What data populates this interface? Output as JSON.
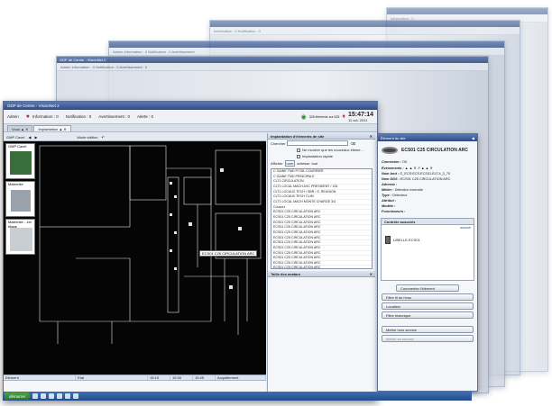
{
  "window": {
    "title": "GDP de Centre - VisionNet 2"
  },
  "background_windows": [
    {
      "title": "GDP de Centre - VisionNet 2",
      "toolbar": "Admin   Information : 0   Notification : 0   Avertissement : 0"
    },
    {
      "title": "GDP de Centre - VisionNet 2",
      "toolbar": "Admin   Information : 0   Notification : 0   Avertissement"
    },
    {
      "title": "GDP de Centre - VisionNet 2",
      "toolbar": "Information : 0   Notification : 0"
    },
    {
      "title": "GDP de Centre",
      "toolbar": "Information : 0"
    }
  ],
  "toolbar": {
    "user": "Admin",
    "information": "Information : 0",
    "notification": "Notification : 0",
    "avertissement": "Avertissement : 0",
    "alerte": "Alerte : 0",
    "unacked": "328 éléments sur 625",
    "time": "15:47:14",
    "date": "11 oct. 2011"
  },
  "tabs": [
    {
      "label": "Vous ▲ ✕"
    },
    {
      "label": "Implantation ▲ ✕"
    }
  ],
  "nav": {
    "site": "GMP Cavel",
    "mode": "Mode édition"
  },
  "thumbnails": [
    "GMP Cavel",
    "Maternite",
    "Maternite - 1er étage"
  ],
  "plan_callout": "ECS01 C25 CIRCULATION ARC",
  "grid_headers": [
    "Elément",
    "Etat",
    "15:15",
    "15:30",
    "15:45",
    "Acquittement"
  ],
  "implantation": {
    "title": "Implantation d'éléments de site",
    "search_label": "Chercher",
    "opt_new": "Ne montrer que les nouveaux éléme...",
    "opt_quick": "Implantation rapide",
    "afficher": "Afficher",
    "afficher_opts": [
      "nom",
      "adresse",
      "tout"
    ],
    "items": [
      "C GAINE TMD P.CSIL COURRIER",
      "C GAINE TMD PRINCIPALE",
      "CLT1 CIRCULATION",
      "CLT1 LOCAL MACH ASC PRESIDENT / 126",
      "CLT1 LOCAUX TECH / SBR / S. REUNION",
      "CLT1 LOCAUX TECH CLIM",
      "CLT1 LOCAL MACH MONTE CHARGE 3/4",
      "Couvcrz",
      "ECS01 C25 CIRCULATION ARC",
      "ECS01 C25 CIRCULATION ARC",
      "ECS01 C25 CIRCULATION ARC",
      "ECS01 C25 CIRCULATION ARC",
      "ECS01 C25 CIRCULATION ARC",
      "ECS01 C25 CIRCULATION ARC",
      "ECS01 C25 CIRCULATION ARC",
      "ECS01 C25 CIRCULATION ARC",
      "ECS01 C25 CIRCULATION ARC",
      "ECS01 C25 CIRCULATION ARC",
      "ECS01 C25 CIRCULATION ARC",
      "ECS01 C25 CIRCULATION ARC",
      "ECS01 C25 CIRCULATION ARC",
      "ECS01 C25 CIRCULATION ARC",
      "ECS01 C25 CIRCULATION ARC",
      "ECS01 C25 CIRCULATION ARC"
    ],
    "selected_index": 20,
    "avatars_title": "Taille des avatars"
  },
  "detail": {
    "title": "Élément du site",
    "object_name": "ECS01 C25 CIRCULATION ARC",
    "props": [
      {
        "k": "Connexion :",
        "v": "OK"
      },
      {
        "k": "Évènements :",
        "v": "▲ ▲ ✕ ↗ ▲ ▲ ✕"
      },
      {
        "k": "Nom brut :",
        "v": "G_ECS:ECS.ECS01.ELT.4_3_70"
      },
      {
        "k": "Nom DDS :",
        "v": "ECS01 C25 CIRCULATION ARC"
      },
      {
        "k": "Adresse :",
        "v": ""
      },
      {
        "k": "Métier :",
        "v": "Détection incendie"
      },
      {
        "k": "Type :",
        "v": "Détecteur"
      },
      {
        "k": "Attribut :",
        "v": ""
      },
      {
        "k": "Modèle :",
        "v": ""
      },
      {
        "k": "Fournisseurs :",
        "v": ""
      }
    ],
    "assoc_title": "Contrôle associés",
    "assoc_link": "associé",
    "control_name": "LIBELLE-ECS01",
    "btn_comment": "Commenter l'élément",
    "btn_filter_flow": "Filtre fil de l'eau",
    "btn_locate": "Localiser",
    "btn_history": "Filtre historique",
    "btn_out_service": "Mettre hors service",
    "btn_in_service": "Mettre en service"
  },
  "taskbar": {
    "start": "démarrer"
  }
}
